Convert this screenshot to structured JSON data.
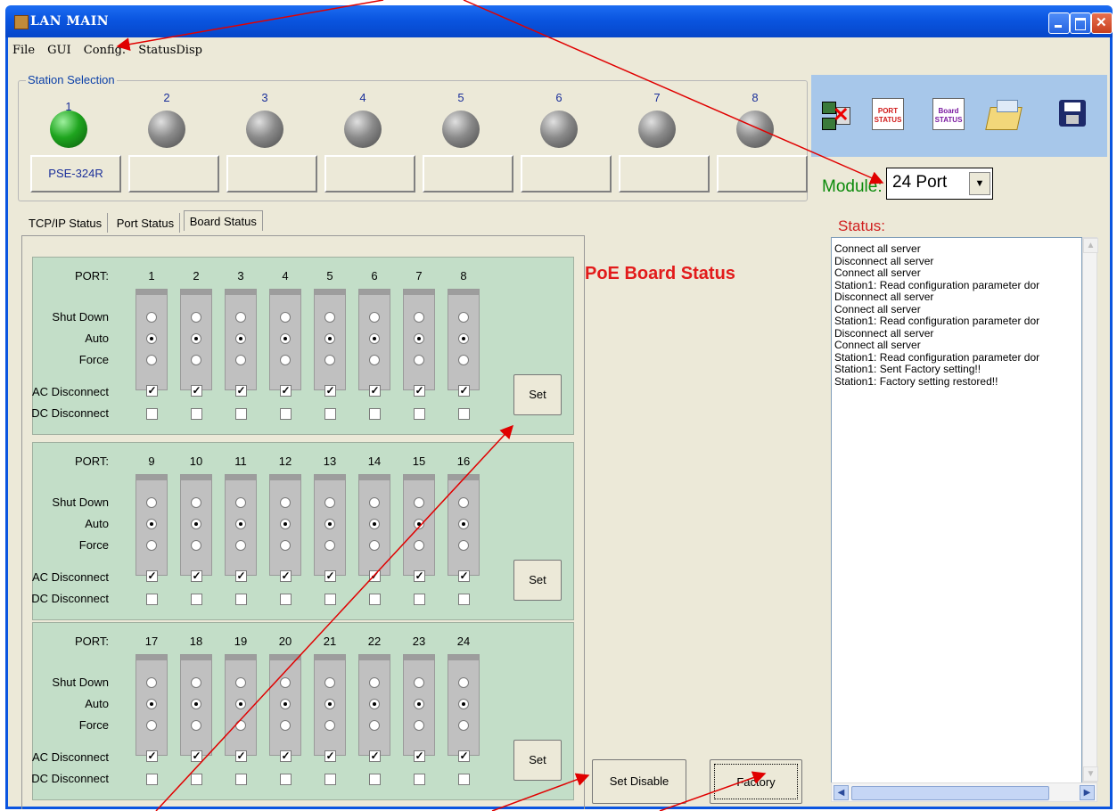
{
  "window": {
    "title": "LAN MAIN"
  },
  "menu": [
    "File",
    "GUI",
    "Config.",
    "StatusDisp"
  ],
  "station_selection": {
    "label": "Station Selection",
    "stations": [
      {
        "number": "1",
        "active": true,
        "device": "PSE-324R"
      },
      {
        "number": "2",
        "active": false,
        "device": ""
      },
      {
        "number": "3",
        "active": false,
        "device": ""
      },
      {
        "number": "4",
        "active": false,
        "device": ""
      },
      {
        "number": "5",
        "active": false,
        "device": ""
      },
      {
        "number": "6",
        "active": false,
        "device": ""
      },
      {
        "number": "7",
        "active": false,
        "device": ""
      },
      {
        "number": "8",
        "active": false,
        "device": ""
      }
    ]
  },
  "toolbar": {
    "port_status_label": "PORT STATUS",
    "board_status_label": "Board STATUS"
  },
  "module": {
    "label": "Module:",
    "value": "24 Port"
  },
  "tabs": [
    "TCP/IP Status",
    "Port Status",
    "Board Status"
  ],
  "board": {
    "title": "PoE Board Status",
    "labels": {
      "port": "PORT:",
      "shutdown": "Shut Down",
      "auto": "Auto",
      "force": "Force",
      "ac": "AC Disconnect",
      "dc": "DC Disconnect"
    },
    "set_label": "Set",
    "groups": [
      {
        "ports": [
          "1",
          "2",
          "3",
          "4",
          "5",
          "6",
          "7",
          "8"
        ]
      },
      {
        "ports": [
          "9",
          "10",
          "11",
          "12",
          "13",
          "14",
          "15",
          "16"
        ]
      },
      {
        "ports": [
          "17",
          "18",
          "19",
          "20",
          "21",
          "22",
          "23",
          "24"
        ]
      }
    ],
    "mode_selected": "Auto",
    "ac_disconnect_checked": true,
    "dc_disconnect_checked": false,
    "set_disable_label": "Set Disable",
    "factory_label": "Factory"
  },
  "status": {
    "label": "Status:",
    "lines": [
      "Connect all server",
      "Disconnect all server",
      "Connect all server",
      "Station1: Read configuration parameter dor",
      "Disconnect all server",
      "Connect all server",
      "Station1: Read configuration parameter dor",
      "Disconnect all server",
      "Connect all server",
      "Station1: Read configuration parameter dor",
      "Station1: Sent Factory setting!!",
      "Station1: Factory setting restored!!"
    ]
  },
  "colors": {
    "titlebar": "#0a55e0",
    "panel_green": "#c3dec8",
    "board_title": "#e21b1b",
    "status_label": "#d02020",
    "module_label": "#0a8a0a",
    "toolbar_bg": "#a7c7ea",
    "annotation_arrow": "#e00000"
  }
}
